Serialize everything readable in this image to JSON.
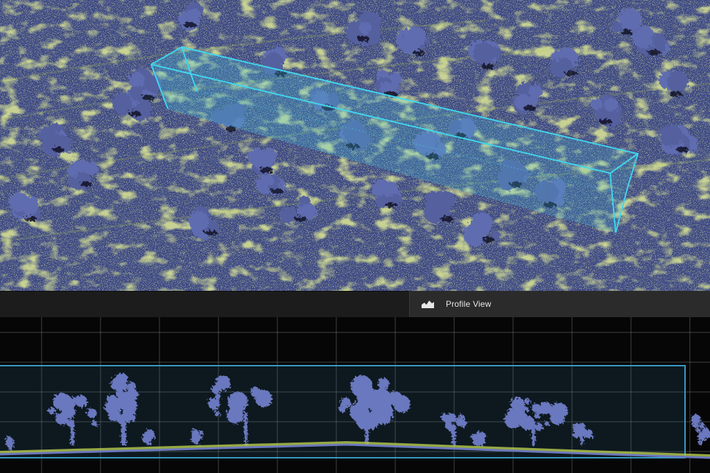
{
  "profile_panel": {
    "tab_label": "Profile View",
    "tab_icon": "profile-chart-icon"
  },
  "colors": {
    "point_cloud_base": "#3f4a86",
    "vegetation_blue": "#5f6cb0",
    "ground_highlight": "#b9cc4d",
    "selection_box": "#3fd6ee",
    "grid_line": "#8c8c8c",
    "panel_background": "#060607"
  }
}
